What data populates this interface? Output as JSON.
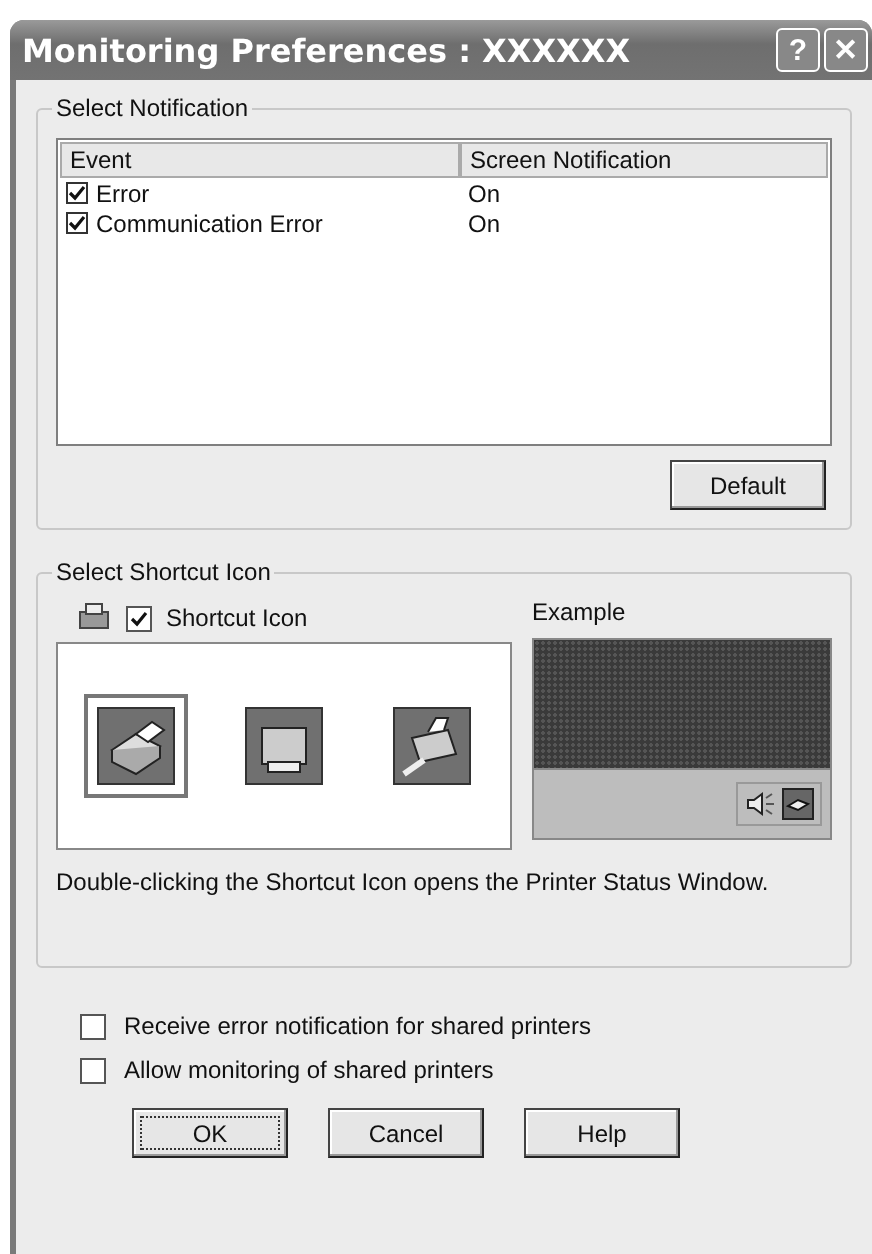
{
  "window": {
    "title": "Monitoring Preferences : XXXXXX",
    "help_button": "?",
    "close_button": "✕"
  },
  "notification": {
    "group_title": "Select Notification",
    "columns": [
      "Event",
      "Screen Notification"
    ],
    "rows": [
      {
        "event": "Error",
        "checked": true,
        "screen_notification": "On"
      },
      {
        "event": "Communication Error",
        "checked": true,
        "screen_notification": "On"
      }
    ],
    "default_button": "Default"
  },
  "shortcut": {
    "group_title": "Select Shortcut Icon",
    "checkbox_label": "Shortcut Icon",
    "checked": true,
    "icons": [
      {
        "kind": "paper",
        "selected": true
      },
      {
        "kind": "box",
        "selected": false
      },
      {
        "kind": "feed",
        "selected": false
      }
    ],
    "example_label": "Example",
    "description": "Double-clicking the Shortcut Icon opens the Printer Status Window."
  },
  "options": [
    {
      "label": "Receive error notification for shared printers",
      "checked": false
    },
    {
      "label": "Allow monitoring of shared printers",
      "checked": false
    }
  ],
  "buttons": [
    {
      "label": "OK",
      "focused": true
    },
    {
      "label": "Cancel",
      "focused": false
    },
    {
      "label": "Help",
      "focused": false
    }
  ]
}
